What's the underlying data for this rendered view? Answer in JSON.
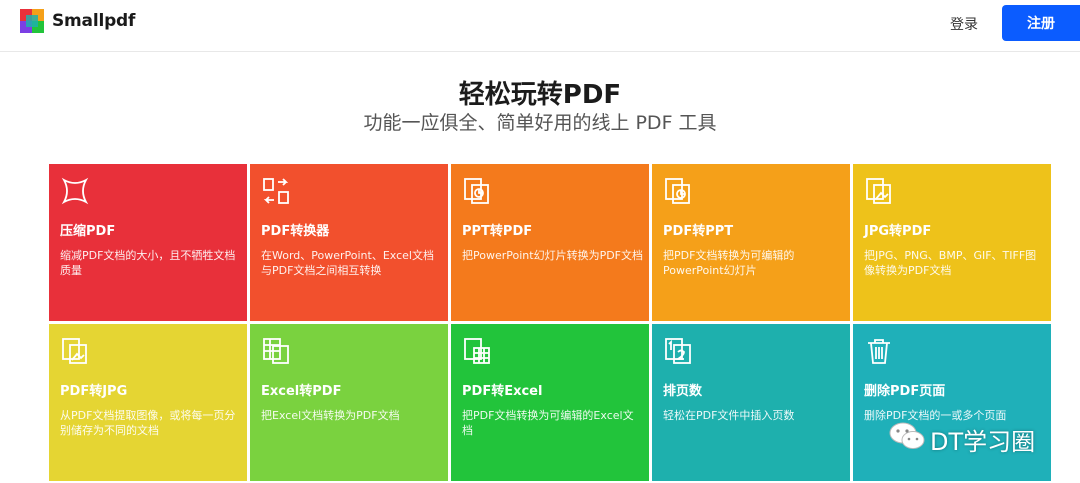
{
  "header": {
    "brand": "Smallpdf",
    "login_label": "登录",
    "signup_label": "注册",
    "accent": "#0b5cff"
  },
  "hero": {
    "title": "轻松玩转PDF",
    "subtitle": "功能一应俱全、简单好用的线上 PDF 工具"
  },
  "tools": [
    {
      "title": "压缩PDF",
      "desc": "缩减PDF文档的大小，且不牺牲文档质量",
      "icon": "compress-icon",
      "color": "#e8303a"
    },
    {
      "title": "PDF转换器",
      "desc": "在Word、PowerPoint、Excel文档与PDF文档之间相互转换",
      "icon": "converter-icon",
      "color": "#f2502d"
    },
    {
      "title": "PPT转PDF",
      "desc": "把PowerPoint幻灯片转换为PDF文档",
      "icon": "ppt-to-pdf-icon",
      "color": "#f47a1c"
    },
    {
      "title": "PDF转PPT",
      "desc": "把PDF文档转换为可编辑的PowerPoint幻灯片",
      "icon": "pdf-to-ppt-icon",
      "color": "#f5a019"
    },
    {
      "title": "JPG转PDF",
      "desc": "把JPG、PNG、BMP、GIF、TIFF图像转换为PDF文档",
      "icon": "jpg-to-pdf-icon",
      "color": "#eec21a"
    },
    {
      "title": "PDF转JPG",
      "desc": "从PDF文档提取图像，或将每一页分别储存为不同的文档",
      "icon": "pdf-to-jpg-icon",
      "color": "#e5d533"
    },
    {
      "title": "Excel转PDF",
      "desc": "把Excel文档转换为PDF文档",
      "icon": "excel-to-pdf-icon",
      "color": "#7ad23f"
    },
    {
      "title": "PDF转Excel",
      "desc": "把PDF文档转换为可编辑的Excel文档",
      "icon": "pdf-to-excel-icon",
      "color": "#22c43b"
    },
    {
      "title": "排页数",
      "desc": "轻松在PDF文件中插入页数",
      "icon": "page-numbers-icon",
      "color": "#1eb0ad"
    },
    {
      "title": "删除PDF页面",
      "desc": "删除PDF文档的一或多个页面",
      "icon": "trash-icon",
      "color": "#1fb0b9"
    }
  ],
  "watermark": {
    "text": "DT学习圈",
    "icon": "wechat-icon"
  }
}
